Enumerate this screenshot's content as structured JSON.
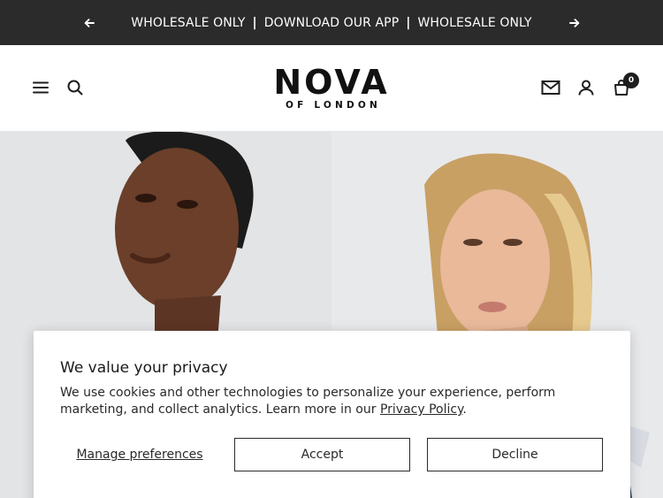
{
  "announcement": {
    "items": [
      "WHOLESALE ONLY",
      "DOWNLOAD OUR APP",
      "WHOLESALE ONLY"
    ],
    "separator": "|",
    "prev_icon": "arrow-left-icon",
    "next_icon": "arrow-right-icon"
  },
  "header": {
    "logo_main": "NOVA",
    "logo_sub": "OF LONDON",
    "icons": [
      "menu-icon",
      "search-icon",
      "mail-icon",
      "account-icon",
      "cart-icon"
    ],
    "cart_count": "0"
  },
  "hero": {
    "images": [
      "model-portrait-left",
      "model-portrait-right"
    ]
  },
  "cookie_banner": {
    "title": "We value your privacy",
    "body_text": "We use cookies and other technologies to personalize your experience, perform marketing, and collect analytics. Learn more in our ",
    "link_text": "Privacy Policy",
    "body_end": ".",
    "manage_label": "Manage preferences",
    "accept_label": "Accept",
    "decline_label": "Decline"
  }
}
